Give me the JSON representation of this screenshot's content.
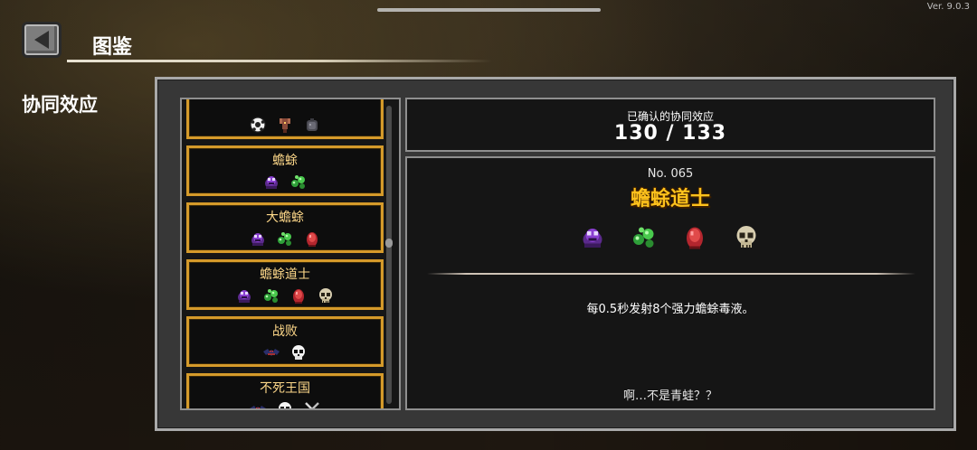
{
  "version": "Ver. 9.0.3",
  "header": {
    "title": "图鉴"
  },
  "section": {
    "title": "协同效应"
  },
  "list": {
    "items": [
      {
        "title": "",
        "icons": [
          "soccer-ball-icon",
          "claw-creature-icon",
          "armor-icon"
        ]
      },
      {
        "title": "蟾蜍",
        "icons": [
          "purple-toad-icon",
          "green-slime-icon"
        ]
      },
      {
        "title": "大蟾蜍",
        "icons": [
          "purple-toad-icon",
          "green-slime-icon",
          "red-egg-icon"
        ]
      },
      {
        "title": "蟾蜍道士",
        "icons": [
          "purple-toad-icon",
          "green-slime-icon",
          "red-egg-icon",
          "skull-icon"
        ]
      },
      {
        "title": "战败",
        "icons": [
          "bat-icon",
          "white-skull-icon"
        ]
      },
      {
        "title": "不死王国",
        "icons": [
          "bat-icon",
          "white-skull-icon",
          "crossed-swords-icon"
        ]
      }
    ]
  },
  "summary": {
    "label": "已确认的协同效应",
    "value": "130 / 133"
  },
  "detail": {
    "number": "No. 065",
    "name": "蟾蜍道士",
    "icons": [
      "purple-toad-icon",
      "green-slime-icon",
      "red-egg-icon",
      "skull-icon"
    ],
    "description": "每0.5秒发射8个强力蟾蜍毒液。",
    "flavor": "啊…不是青蛙？？"
  }
}
